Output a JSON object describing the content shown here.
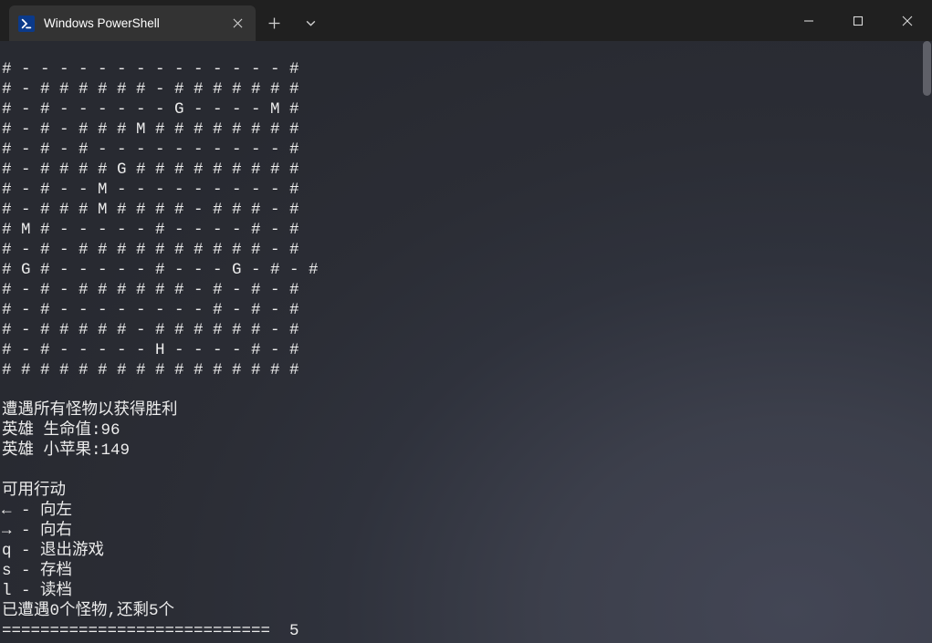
{
  "tab": {
    "title": "Windows PowerShell"
  },
  "game": {
    "map": [
      "# - - - - - - - - - - - - - - #",
      "# - # # # # # # - # # # # # # #",
      "# - # - - - - - - G - - - - M #",
      "# - # - # # # M # # # # # # # #",
      "# - # - # - - - - - - - - - - #",
      "# - # # # # G # # # # # # # # #",
      "# - # - - M - - - - - - - - - #",
      "# - # # # M # # # # - # # # - #",
      "# M # - - - - - # - - - - # - #",
      "# - # - # # # # # # # # # # - #",
      "# G # - - - - - # - - - G - # - #",
      "# - # - # # # # # # - # - # - #",
      "# - # - - - - - - - - # - # - #",
      "# - # # # # # - # # # # # # - #",
      "# - # - - - - - H - - - - # - #",
      "# # # # # # # # # # # # # # # #"
    ],
    "objective": "遭遇所有怪物以获得胜利",
    "hero_hp_label": "英雄 生命值:",
    "hero_hp": 96,
    "hero_apple_label": "英雄 小苹果:",
    "hero_apple": 149,
    "actions_header": "可用行动",
    "actions": [
      {
        "key": "←",
        "desc": "向左"
      },
      {
        "key": "→",
        "desc": "向右"
      },
      {
        "key": "q",
        "desc": "退出游戏"
      },
      {
        "key": "s",
        "desc": "存档"
      },
      {
        "key": "l",
        "desc": "读档"
      }
    ],
    "encounter_prefix": "已遭遇",
    "encountered": 0,
    "encounter_mid": "个怪物,还剩",
    "remaining": 5,
    "encounter_suffix": "个",
    "divider": "============================  5"
  }
}
